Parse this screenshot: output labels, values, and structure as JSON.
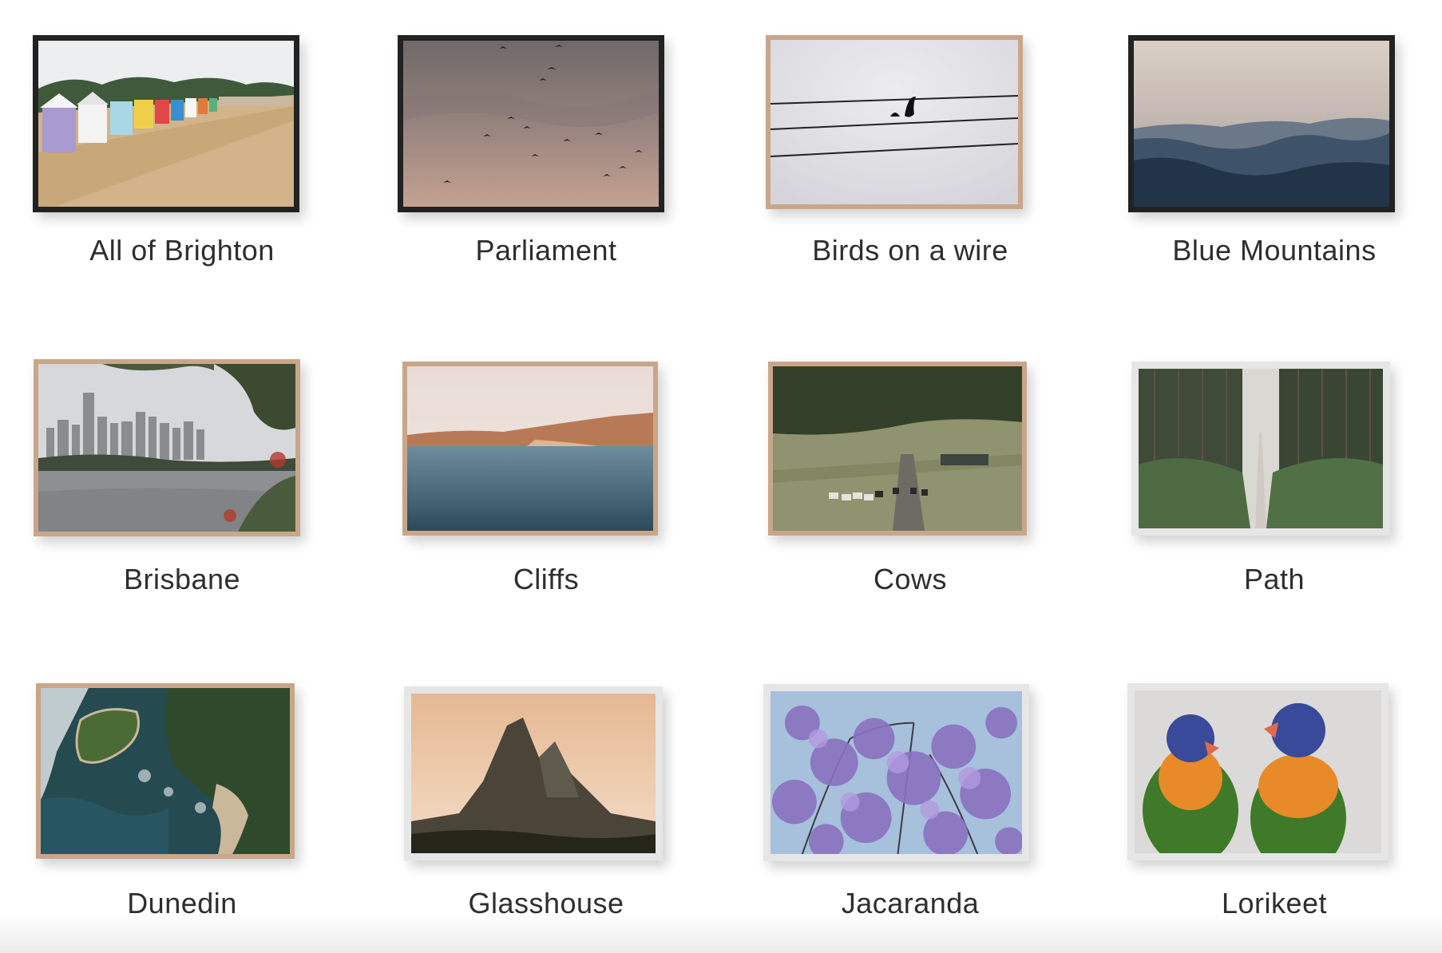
{
  "gallery": {
    "items": [
      {
        "title": "All of Brighton",
        "frame": "black",
        "image_icon": "beach-huts-icon"
      },
      {
        "title": "Parliament",
        "frame": "black",
        "image_icon": "birds-sky-icon"
      },
      {
        "title": "Birds on a wire",
        "frame": "oak",
        "image_icon": "birds-wire-icon"
      },
      {
        "title": "Blue Mountains",
        "frame": "black",
        "image_icon": "mountains-icon"
      },
      {
        "title": "Brisbane",
        "frame": "oak",
        "image_icon": "city-skyline-icon"
      },
      {
        "title": "Cliffs",
        "frame": "oak",
        "image_icon": "cliffs-icon"
      },
      {
        "title": "Cows",
        "frame": "oak",
        "image_icon": "cows-road-icon"
      },
      {
        "title": "Path",
        "frame": "white",
        "image_icon": "forest-path-icon"
      },
      {
        "title": "Dunedin",
        "frame": "oak",
        "image_icon": "coastline-aerial-icon"
      },
      {
        "title": "Glasshouse",
        "frame": "white",
        "image_icon": "mountain-peak-icon"
      },
      {
        "title": "Jacaranda",
        "frame": "white",
        "image_icon": "jacaranda-icon"
      },
      {
        "title": "Lorikeet",
        "frame": "white",
        "image_icon": "lorikeet-icon"
      }
    ]
  }
}
